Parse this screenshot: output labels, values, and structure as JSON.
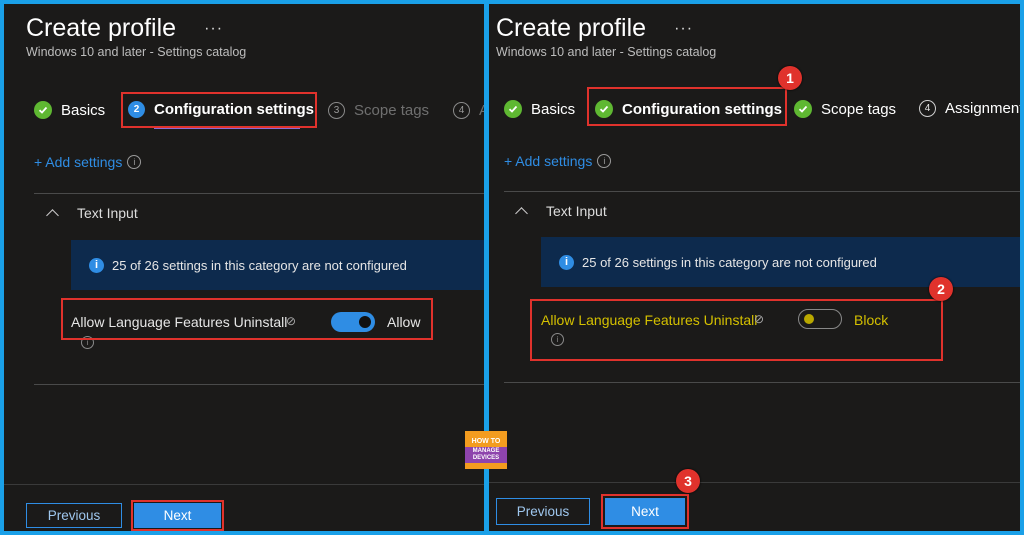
{
  "left": {
    "title": "Create profile",
    "more": "···",
    "subtitle": "Windows 10 and later - Settings catalog",
    "steps": [
      {
        "number": "",
        "label": "Basics",
        "state": "complete"
      },
      {
        "number": "2",
        "label": "Configuration settings",
        "state": "current"
      },
      {
        "number": "3",
        "label": "Scope tags",
        "state": "pending"
      },
      {
        "number": "4",
        "label": "A",
        "state": "pending"
      }
    ],
    "add_settings": "+ Add settings",
    "section": "Text Input",
    "info_banner": "25 of 26 settings in this category are not configured",
    "setting_label": "Allow Language Features Uninstall",
    "toggle_value": "Allow",
    "toggle_on": true,
    "prev_label": "Previous",
    "next_label": "Next"
  },
  "right": {
    "title": "Create profile",
    "more": "···",
    "subtitle": "Windows 10 and later - Settings catalog",
    "steps": [
      {
        "number": "",
        "label": "Basics",
        "state": "complete"
      },
      {
        "number": "",
        "label": "Configuration settings",
        "state": "complete"
      },
      {
        "number": "",
        "label": "Scope tags",
        "state": "complete"
      },
      {
        "number": "4",
        "label": "Assignment",
        "state": "pending"
      }
    ],
    "add_settings": "+ Add settings",
    "section": "Text Input",
    "info_banner": "25 of 26 settings in this category are not configured",
    "setting_label": "Allow Language Features Uninstall",
    "toggle_value": "Block",
    "toggle_on": false,
    "prev_label": "Previous",
    "next_label": "Next"
  },
  "callouts": [
    "1",
    "2",
    "3"
  ],
  "logo": {
    "line1": "HOW TO",
    "line2": "MANAGE DEVICES"
  },
  "colors": {
    "accent": "#2f8de4",
    "highlight": "#e0322c",
    "complete": "#5fb832",
    "block_text": "#d4c000"
  }
}
